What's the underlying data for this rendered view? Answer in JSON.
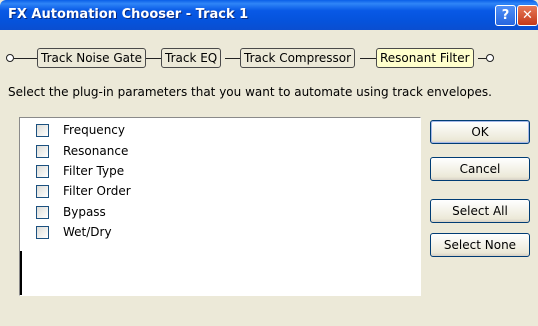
{
  "window": {
    "title": "FX Automation Chooser - Track 1"
  },
  "titlebar": {
    "help_glyph": "?",
    "close_glyph": "✕"
  },
  "chain": {
    "nodes": [
      {
        "label": "Track Noise Gate"
      },
      {
        "label": "Track EQ"
      },
      {
        "label": "Track Compressor"
      },
      {
        "label": "Resonant Filter"
      }
    ],
    "active_color": "#ffffcc"
  },
  "instructions": "Select the plug-in parameters that you want to automate using track envelopes.",
  "parameters": [
    {
      "label": "Frequency",
      "checked": false
    },
    {
      "label": "Resonance",
      "checked": false
    },
    {
      "label": "Filter Type",
      "checked": false
    },
    {
      "label": "Filter Order",
      "checked": false
    },
    {
      "label": "Bypass",
      "checked": false
    },
    {
      "label": "Wet/Dry",
      "checked": false
    }
  ],
  "buttons": {
    "ok": "OK",
    "cancel": "Cancel",
    "select_all": "Select All",
    "select_none": "Select None"
  }
}
